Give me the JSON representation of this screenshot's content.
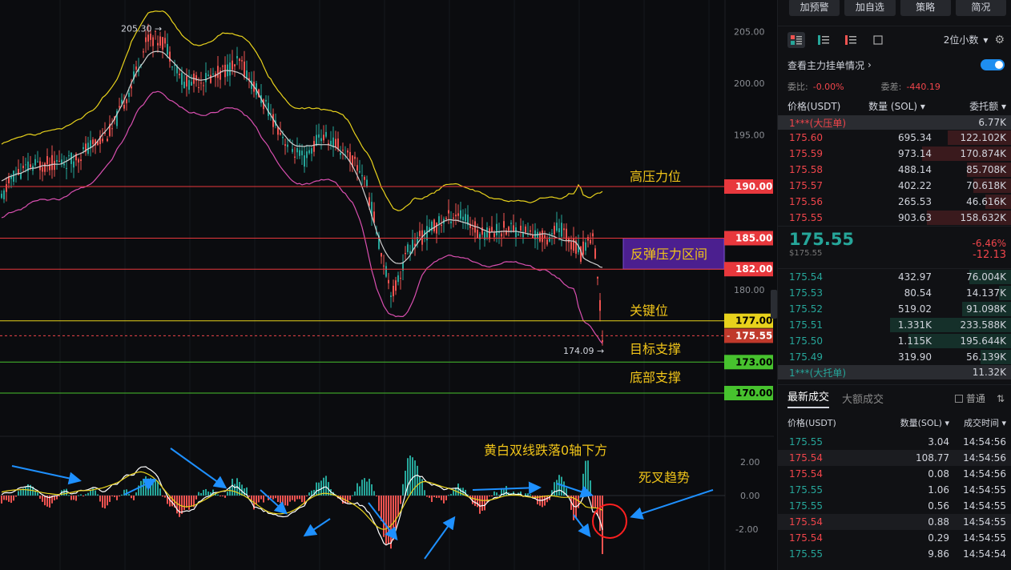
{
  "chart_data": {
    "type": "candlestick",
    "price_axis": {
      "ticks": [
        "205.00",
        "200.00",
        "195.00",
        "180.00"
      ],
      "range": [
        168.2,
        207.9
      ]
    },
    "indicator_axis": {
      "ticks": [
        "2.00",
        "0.00",
        "-2.00"
      ]
    },
    "bollinger_bands": [
      "upper",
      "middle",
      "lower"
    ],
    "price_levels": [
      {
        "value": 190.0,
        "label": "190.00",
        "annotation": "高压力位",
        "line_color": "#e8383d",
        "tag_bg": "#e8383d",
        "tag_text": "#ffffff"
      },
      {
        "value": 185.0,
        "label": "185.00",
        "annotation": "",
        "line_color": "#e8383d",
        "tag_bg": "#e8383d",
        "tag_text": "#ffffff"
      },
      {
        "value": 182.0,
        "label": "182.00",
        "annotation": "",
        "line_color": "#e8383d",
        "tag_bg": "#e8383d",
        "tag_text": "#ffffff"
      },
      {
        "value": 177.0,
        "label": "177.00",
        "annotation": "关键位",
        "line_color": "#e8d21c",
        "tag_bg": "#e8d21c",
        "tag_text": "#000000"
      },
      {
        "value": 173.0,
        "label": "173.00",
        "annotation": "目标支撑",
        "line_color": "#47c22e",
        "tag_bg": "#47c22e",
        "tag_text": "#000000"
      },
      {
        "value": 170.0,
        "label": "170.00",
        "annotation": "底部支撑",
        "line_color": "#47c22e",
        "tag_bg": "#47c22e",
        "tag_text": "#000000"
      }
    ],
    "current_price": {
      "value": 175.55,
      "label": "175.55",
      "color": "#f0454b"
    },
    "zone": {
      "from": 182.0,
      "to": 185.0,
      "label": "反弹压力区间",
      "color": "#4b1f8f"
    },
    "high_marker": {
      "value": 205.3,
      "label": "205.30"
    },
    "low_marker": {
      "value": 174.09,
      "label": "174.09"
    },
    "annotations": [
      {
        "text": "黄白双线跌落0轴下方",
        "color": "#f0c419"
      },
      {
        "text": "死叉趋势",
        "color": "#f0c419"
      }
    ],
    "colors": {
      "up": "#26a69a",
      "down": "#ef5350",
      "bb_upper": "#e8d21c",
      "bb_mid": "#d0d0d0",
      "bb_lower": "#d94fb0",
      "macd_dif": "#ffffff",
      "macd_dea": "#e8d21c",
      "arrow": "#1e90ff"
    }
  },
  "toolbar": {
    "buttons": [
      "加预警",
      "加自选",
      "策略",
      "简况"
    ]
  },
  "orderbook": {
    "precision": "2位小数",
    "view_label": "查看主力挂单情况",
    "ratio_label": "委比:",
    "ratio_value": "-0.00%",
    "diff_label": "委差:",
    "diff_value": "-440.19",
    "headers": [
      "价格(USDT)",
      "数量 (SOL)",
      "委托额"
    ],
    "ask_band": {
      "label": "1***(大压单)",
      "value": "6.77K"
    },
    "asks": [
      {
        "price": "175.60",
        "qty": "695.34",
        "total": "122.102K",
        "depth": 0.27
      },
      {
        "price": "175.59",
        "qty": "973.14",
        "total": "170.874K",
        "depth": 0.38
      },
      {
        "price": "175.58",
        "qty": "488.14",
        "total": "85.708K",
        "depth": 0.19
      },
      {
        "price": "175.57",
        "qty": "402.22",
        "total": "70.618K",
        "depth": 0.16
      },
      {
        "price": "175.56",
        "qty": "265.53",
        "total": "46.616K",
        "depth": 0.11
      },
      {
        "price": "175.55",
        "qty": "903.63",
        "total": "158.632K",
        "depth": 0.36
      }
    ],
    "last_price": "175.55",
    "last_price_usd": "$175.55",
    "change_pct": "-6.46%",
    "change_abs": "-12.13",
    "bids": [
      {
        "price": "175.54",
        "qty": "432.97",
        "total": "76.004K",
        "depth": 0.18
      },
      {
        "price": "175.53",
        "qty": "80.54",
        "total": "14.137K",
        "depth": 0.05
      },
      {
        "price": "175.52",
        "qty": "519.02",
        "total": "91.098K",
        "depth": 0.21
      },
      {
        "price": "175.51",
        "qty": "1.331K",
        "total": "233.588K",
        "depth": 0.52
      },
      {
        "price": "175.50",
        "qty": "1.115K",
        "total": "195.644K",
        "depth": 0.44
      },
      {
        "price": "175.49",
        "qty": "319.90",
        "total": "56.139K",
        "depth": 0.13
      }
    ],
    "bid_band": {
      "label": "1***(大托单)",
      "value": "11.32K"
    }
  },
  "trades": {
    "tabs": [
      "最新成交",
      "大额成交"
    ],
    "filter_label": "普通",
    "headers": [
      "价格(USDT)",
      "数量(SOL)",
      "成交时间"
    ],
    "rows": [
      {
        "price": "175.55",
        "qty": "3.04",
        "time": "14:54:56",
        "side": "buy"
      },
      {
        "price": "175.54",
        "qty": "108.77",
        "time": "14:54:56",
        "side": "sell"
      },
      {
        "price": "175.54",
        "qty": "0.08",
        "time": "14:54:56",
        "side": "sell"
      },
      {
        "price": "175.55",
        "qty": "1.06",
        "time": "14:54:55",
        "side": "buy"
      },
      {
        "price": "175.55",
        "qty": "0.56",
        "time": "14:54:55",
        "side": "buy"
      },
      {
        "price": "175.54",
        "qty": "0.88",
        "time": "14:54:55",
        "side": "sell"
      },
      {
        "price": "175.54",
        "qty": "0.29",
        "time": "14:54:55",
        "side": "sell"
      },
      {
        "price": "175.55",
        "qty": "9.86",
        "time": "14:54:54",
        "side": "buy"
      }
    ]
  }
}
